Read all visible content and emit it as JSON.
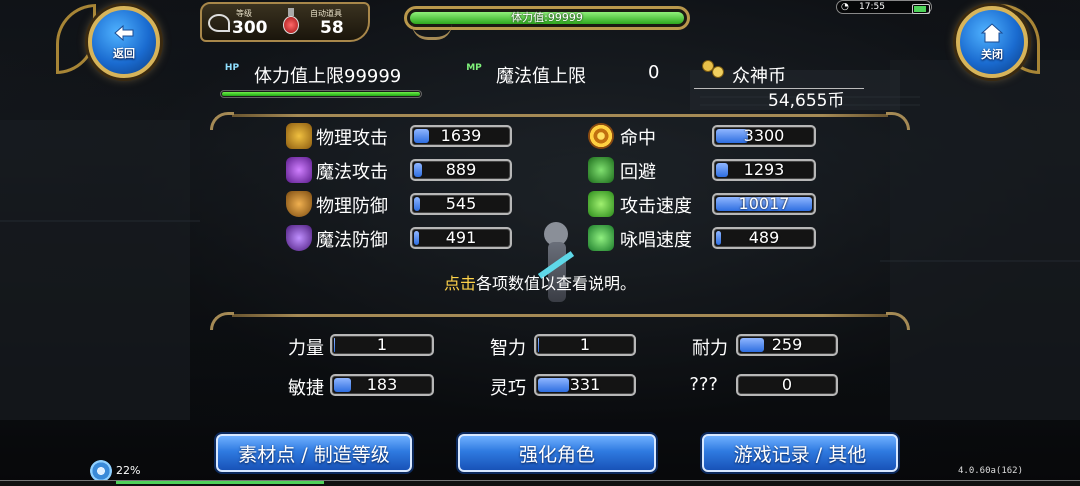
{
  "nav": {
    "back_label": "返回",
    "close_label": "关闭"
  },
  "top": {
    "level_label": "等级",
    "level_value": "300",
    "potion_label": "自动道具",
    "potion_value": "58",
    "hp_bar_text": "体力值:99999",
    "clock": "17:55"
  },
  "summary": {
    "hp_badge": "HP",
    "hp_max_label": "体力值上限99999",
    "mp_badge": "MP",
    "mp_max_label": "魔法值上限",
    "mp_max_value": "0",
    "coin_label": "众神币",
    "coin_value": "54,655币"
  },
  "combat_stats": [
    {
      "label": "物理攻击",
      "value": "1639",
      "fill": 0.16
    },
    {
      "label": "魔法攻击",
      "value": "889",
      "fill": 0.09
    },
    {
      "label": "物理防御",
      "value": "545",
      "fill": 0.06
    },
    {
      "label": "魔法防御",
      "value": "491",
      "fill": 0.05
    },
    {
      "label": "命中",
      "value": "3300",
      "fill": 0.33
    },
    {
      "label": "回避",
      "value": "1293",
      "fill": 0.13
    },
    {
      "label": "攻击速度",
      "value": "10017",
      "fill": 1.0
    },
    {
      "label": "咏唱速度",
      "value": "489",
      "fill": 0.05
    }
  ],
  "hint": {
    "highlight": "点击",
    "rest": "各项数值以查看说明。"
  },
  "attributes": [
    {
      "label": "力量",
      "value": "1",
      "fill": 0.01
    },
    {
      "label": "智力",
      "value": "1",
      "fill": 0.01
    },
    {
      "label": "耐力",
      "value": "259",
      "fill": 0.26
    },
    {
      "label": "敏捷",
      "value": "183",
      "fill": 0.18
    },
    {
      "label": "灵巧",
      "value": "331",
      "fill": 0.33
    },
    {
      "label": "???",
      "value": "0",
      "fill": 0.0
    }
  ],
  "buttons": {
    "materials": "素材点 / 制造等级",
    "enhance": "强化角色",
    "records": "游戏记录 / 其他"
  },
  "footer": {
    "progress_text": "22%",
    "progress": 0.22,
    "version": "4.0.60a(162)"
  },
  "colors": {
    "gold_frame": "#b9984c",
    "bar_blue": "#2e6ee0",
    "button_blue": "#2f7ae0",
    "hint_yellow": "#ffd34a"
  }
}
